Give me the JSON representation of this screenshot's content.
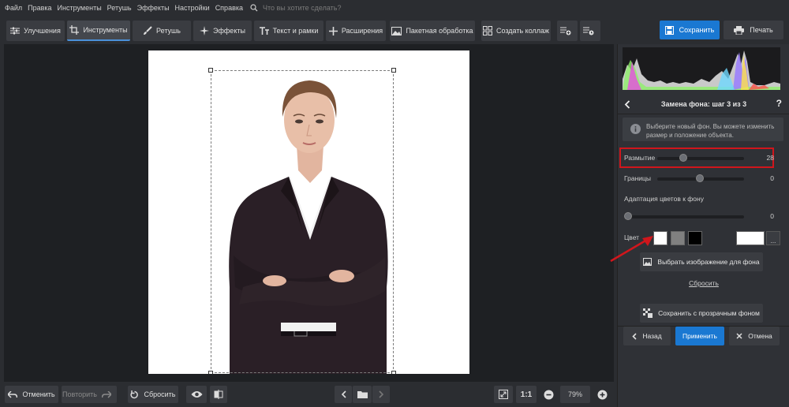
{
  "menu": {
    "items": [
      "Файл",
      "Правка",
      "Инструменты",
      "Ретушь",
      "Эффекты",
      "Настройки",
      "Справка"
    ],
    "search_placeholder": "Что вы хотите сделать?"
  },
  "tabs": [
    {
      "label": "Улучшения",
      "icon": "sliders-icon",
      "active": false
    },
    {
      "label": "Инструменты",
      "icon": "crop-icon",
      "active": true
    },
    {
      "label": "Ретушь",
      "icon": "brush-icon",
      "active": false
    },
    {
      "label": "Эффекты",
      "icon": "sparkle-icon",
      "active": false
    },
    {
      "label": "Текст и рамки",
      "icon": "text-icon",
      "active": false
    },
    {
      "label": "Расширения",
      "icon": "plus-icon",
      "active": false
    },
    {
      "label": "Пакетная обработка",
      "icon": "image-stack-icon",
      "active": false
    },
    {
      "label": "Создать коллаж",
      "icon": "grid-icon",
      "active": false
    }
  ],
  "toolbar": {
    "save_label": "Сохранить",
    "print_label": "Печать"
  },
  "panel": {
    "step_title": "Замена фона: шаг 3 из 3",
    "help": "?",
    "info": "Выберите новый фон. Вы можете изменить размер и положение объекта.",
    "sliders": [
      {
        "label": "Размытие",
        "value": "28",
        "fraction": 0.35
      },
      {
        "label": "Границы",
        "value": "0",
        "fraction": 0.5
      },
      {
        "label": "Адаптация цветов к фону",
        "value": "0",
        "fraction": 0.0
      }
    ],
    "color_label": "Цвет",
    "swatches": [
      "#ffffff",
      "#808080",
      "#000000"
    ],
    "custom_color": "#ffffff",
    "more_label": "...",
    "choose_image_label": "Выбрать изображение для фона",
    "reset_link": "Сбросить",
    "save_transparent_label": "Сохранить с прозрачным фоном",
    "back_label": "Назад",
    "apply_label": "Применить",
    "cancel_label": "Отмена"
  },
  "bottom": {
    "undo_label": "Отменить",
    "redo_label": "Повторить",
    "reset_label": "Сбросить",
    "ratio_label": "1:1",
    "zoom_value": "79%"
  },
  "colors": {
    "accent": "#1a78d2",
    "highlight": "#d0161c",
    "background": "#2b2d31"
  }
}
